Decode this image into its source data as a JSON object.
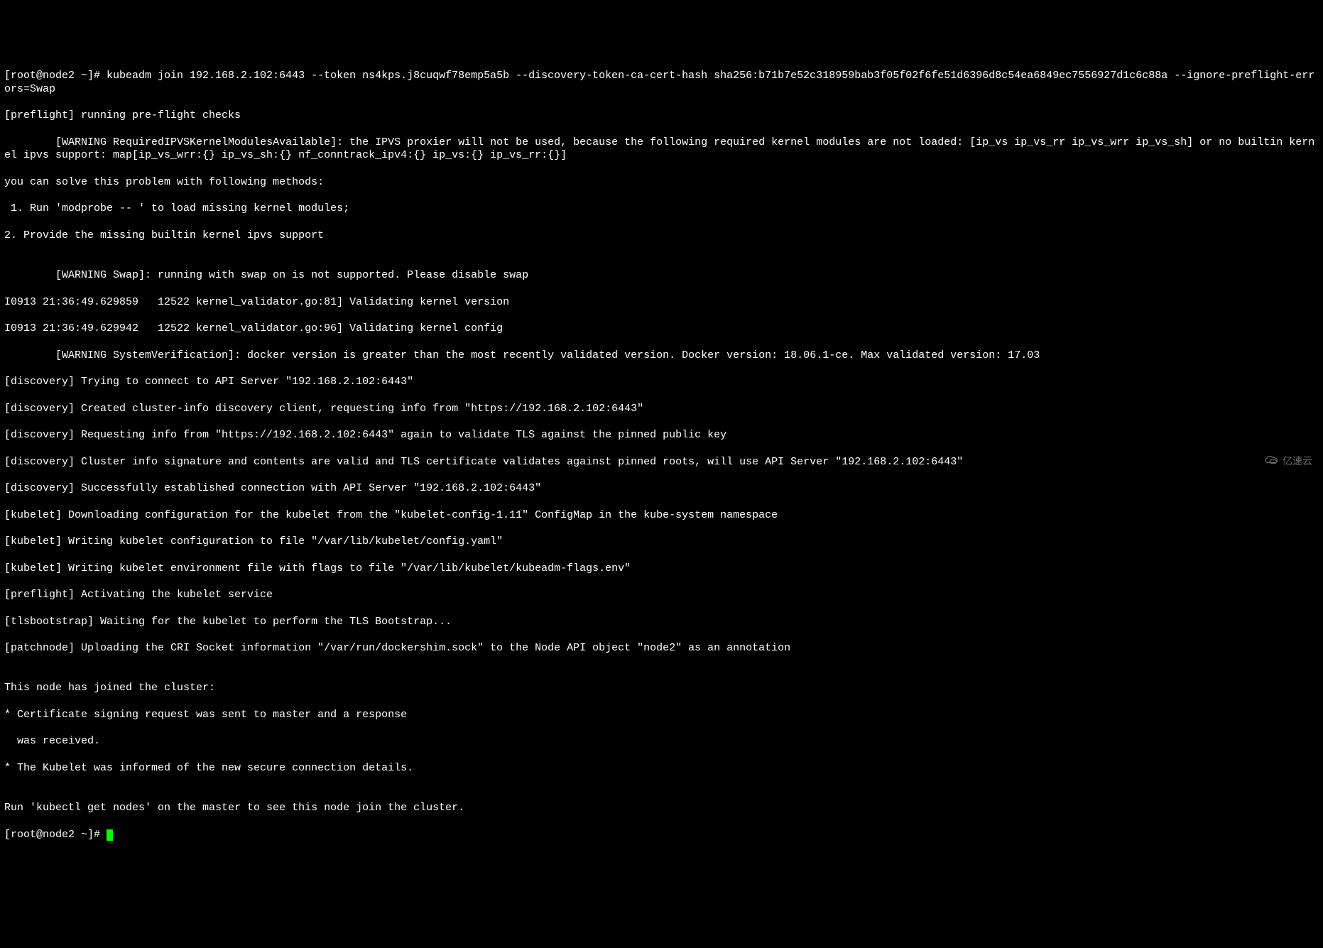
{
  "terminal": {
    "lines": [
      "[root@node2 ~]# kubeadm join 192.168.2.102:6443 --token ns4kps.j8cuqwf78emp5a5b --discovery-token-ca-cert-hash sha256:b71b7e52c318959bab3f05f02f6fe51d6396d8c54ea6849ec7556927d1c6c88a --ignore-preflight-errors=Swap",
      "[preflight] running pre-flight checks",
      "        [WARNING RequiredIPVSKernelModulesAvailable]: the IPVS proxier will not be used, because the following required kernel modules are not loaded: [ip_vs ip_vs_rr ip_vs_wrr ip_vs_sh] or no builtin kernel ipvs support: map[ip_vs_wrr:{} ip_vs_sh:{} nf_conntrack_ipv4:{} ip_vs:{} ip_vs_rr:{}]",
      "you can solve this problem with following methods:",
      " 1. Run 'modprobe -- ' to load missing kernel modules;",
      "2. Provide the missing builtin kernel ipvs support",
      "",
      "        [WARNING Swap]: running with swap on is not supported. Please disable swap",
      "I0913 21:36:49.629859   12522 kernel_validator.go:81] Validating kernel version",
      "I0913 21:36:49.629942   12522 kernel_validator.go:96] Validating kernel config",
      "        [WARNING SystemVerification]: docker version is greater than the most recently validated version. Docker version: 18.06.1-ce. Max validated version: 17.03",
      "[discovery] Trying to connect to API Server \"192.168.2.102:6443\"",
      "[discovery] Created cluster-info discovery client, requesting info from \"https://192.168.2.102:6443\"",
      "[discovery] Requesting info from \"https://192.168.2.102:6443\" again to validate TLS against the pinned public key",
      "[discovery] Cluster info signature and contents are valid and TLS certificate validates against pinned roots, will use API Server \"192.168.2.102:6443\"",
      "[discovery] Successfully established connection with API Server \"192.168.2.102:6443\"",
      "[kubelet] Downloading configuration for the kubelet from the \"kubelet-config-1.11\" ConfigMap in the kube-system namespace",
      "[kubelet] Writing kubelet configuration to file \"/var/lib/kubelet/config.yaml\"",
      "[kubelet] Writing kubelet environment file with flags to file \"/var/lib/kubelet/kubeadm-flags.env\"",
      "[preflight] Activating the kubelet service",
      "[tlsbootstrap] Waiting for the kubelet to perform the TLS Bootstrap...",
      "[patchnode] Uploading the CRI Socket information \"/var/run/dockershim.sock\" to the Node API object \"node2\" as an annotation",
      "",
      "This node has joined the cluster:",
      "* Certificate signing request was sent to master and a response",
      "  was received.",
      "* The Kubelet was informed of the new secure connection details.",
      "",
      "Run 'kubectl get nodes' on the master to see this node join the cluster."
    ],
    "prompt_final": "[root@node2 ~]# "
  },
  "watermark": {
    "text": "亿速云"
  }
}
